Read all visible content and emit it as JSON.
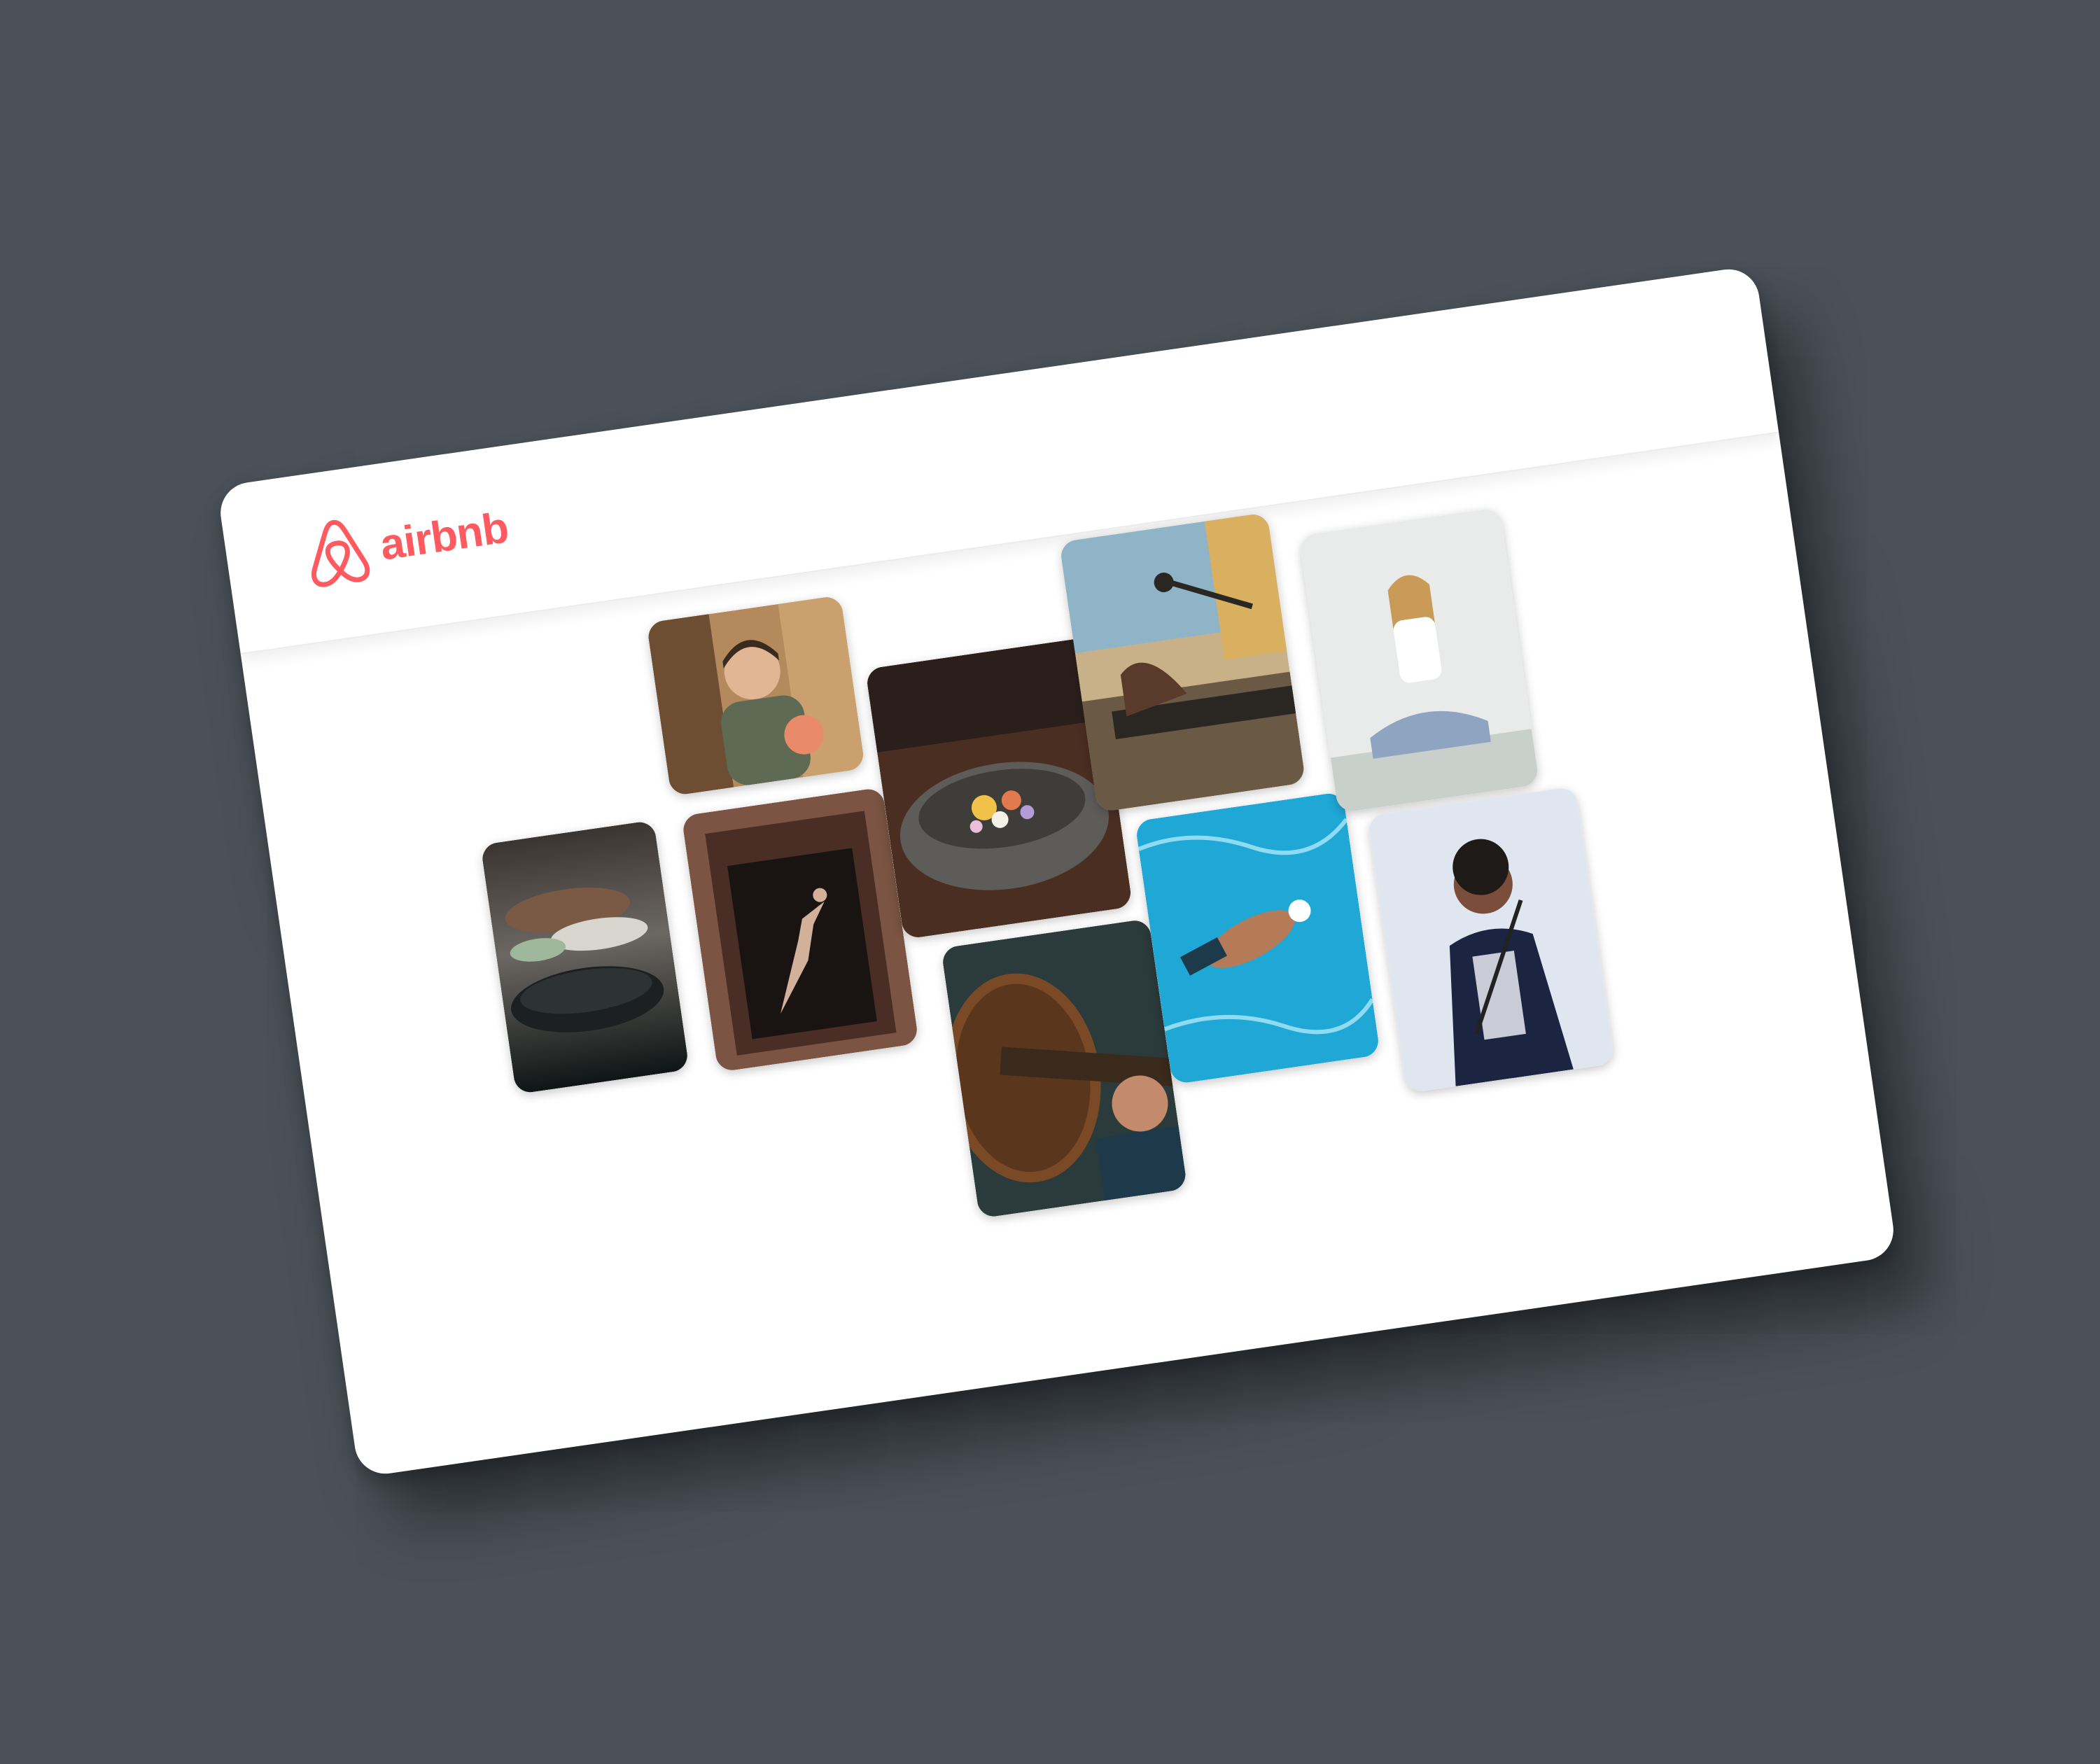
{
  "brand": {
    "name": "airbnb",
    "color": "#ff5a5f"
  },
  "page": {
    "background": "#4a5159",
    "card_background": "#ffffff"
  },
  "photos": [
    {
      "icon": "cooking-pot-photo"
    },
    {
      "icon": "chef-woman-photo"
    },
    {
      "icon": "dancer-doorway-photo"
    },
    {
      "icon": "food-bowl-photo"
    },
    {
      "icon": "guitar-photo"
    },
    {
      "icon": "keyboard-microphone-photo"
    },
    {
      "icon": "swimmer-pool-photo"
    },
    {
      "icon": "yoga-woman-photo"
    },
    {
      "icon": "singer-microphone-photo"
    }
  ]
}
